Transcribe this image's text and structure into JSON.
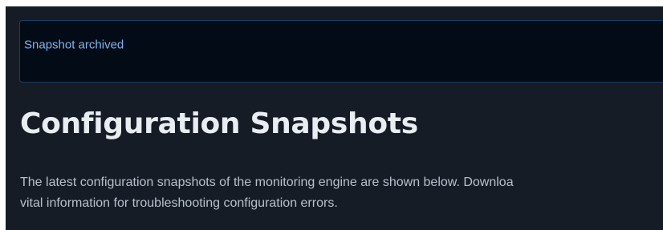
{
  "alert": {
    "message": "Snapshot archived"
  },
  "page": {
    "title": "Configuration Snapshots",
    "description_line1": "The latest configuration snapshots of the monitoring engine are shown below. Downloa",
    "description_line2": "vital information for troubleshooting configuration errors."
  },
  "colors": {
    "page_background": "#151c26",
    "alert_background": "#020b16",
    "alert_border": "#1a3e64",
    "alert_text": "#7fb4ee",
    "title_text": "#e8edf2",
    "body_text": "#b8c0cb"
  }
}
